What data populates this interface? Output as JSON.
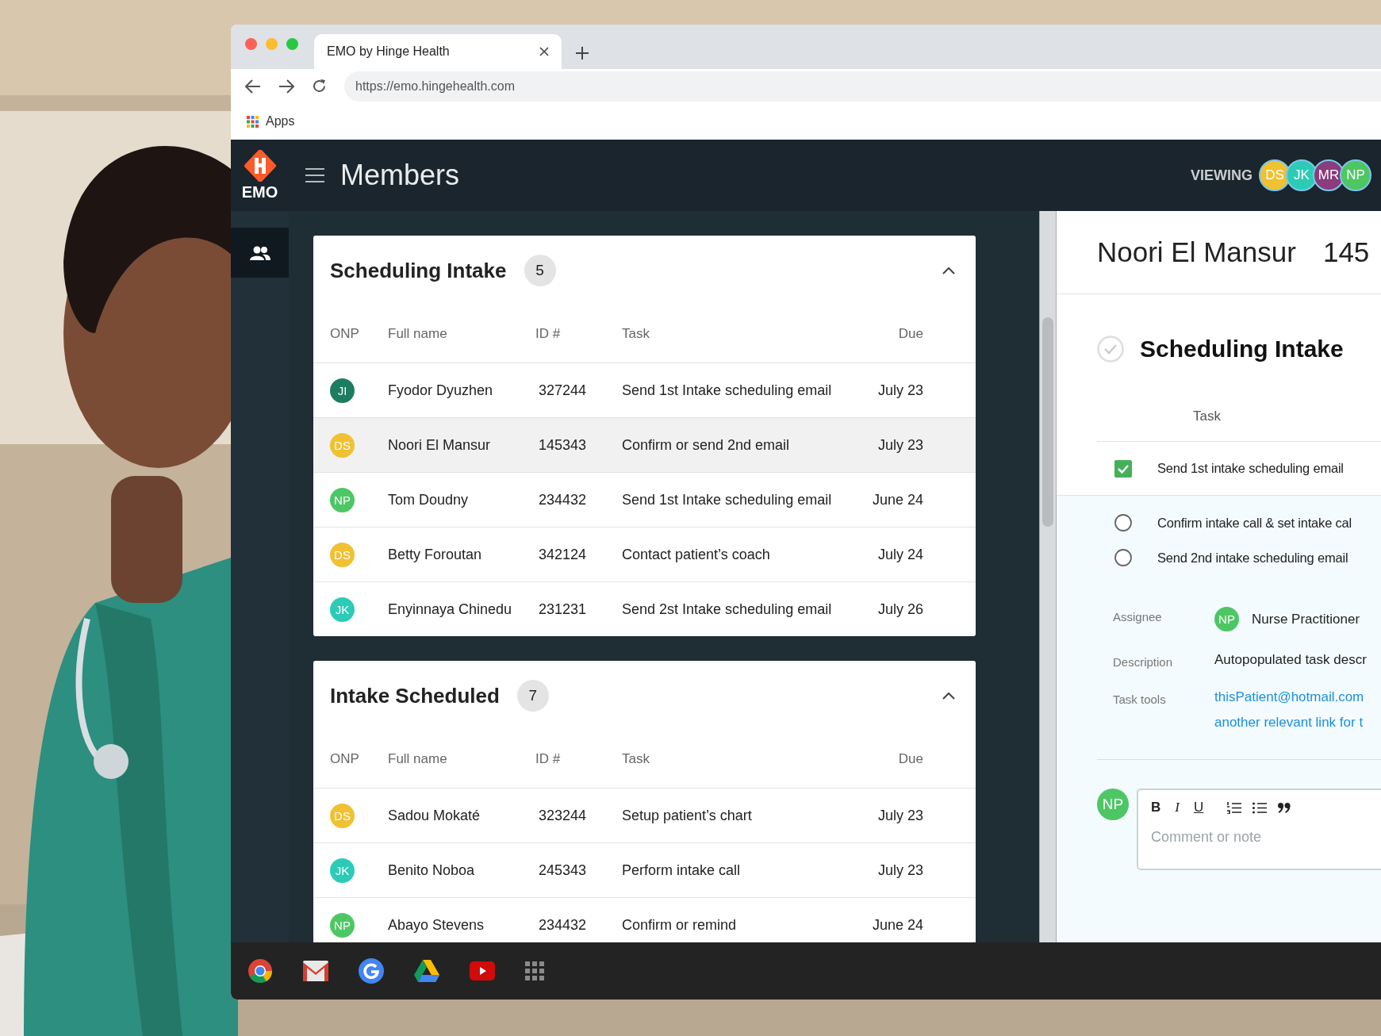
{
  "browser": {
    "tab": {
      "title": "EMO by Hinge Health"
    },
    "url": "https://emo.hingehealth.com",
    "bookmarks": [
      {
        "label": "Apps"
      }
    ]
  },
  "app": {
    "logo": "EMO",
    "title": "Members",
    "viewing_label": "VIEWING",
    "viewers": [
      {
        "initials": "DS",
        "color": "#f0c132"
      },
      {
        "initials": "JK",
        "color": "#2ccbb6"
      },
      {
        "initials": "MR",
        "color": "#8a3c7c"
      },
      {
        "initials": "NP",
        "color": "#4cc764"
      }
    ]
  },
  "sidebar": {
    "items": [
      {
        "selected": true
      }
    ]
  },
  "groups": [
    {
      "title": "Scheduling Intake",
      "count": "5",
      "expanded": true,
      "columns": [
        "ONP",
        "Full name",
        "ID #",
        "Task",
        "Due"
      ],
      "rows": [
        {
          "initials": "JI",
          "color": "#1d7d60",
          "name": "Fyodor Dyuzhen",
          "id": "327244",
          "task": "Send 1st Intake scheduling email",
          "due": "July 23",
          "selected": false
        },
        {
          "initials": "DS",
          "color": "#f0c132",
          "name": "Noori El Mansur",
          "id": "145343",
          "task": "Confirm or send 2nd email",
          "due": "July 23",
          "selected": true
        },
        {
          "initials": "NP",
          "color": "#4cc764",
          "name": "Tom Doudny",
          "id": "234432",
          "task": "Send 1st Intake scheduling email",
          "due": "June 24",
          "selected": false
        },
        {
          "initials": "DS",
          "color": "#f0c132",
          "name": "Betty Foroutan",
          "id": "342124",
          "task": "Contact patient’s coach",
          "due": "July 24",
          "selected": false
        },
        {
          "initials": "JK",
          "color": "#2ccbb6",
          "name": "Enyinnaya Chinedu",
          "id": "231231",
          "task": "Send 2st Intake scheduling email",
          "due": "July 26",
          "selected": false
        }
      ]
    },
    {
      "title": "Intake Scheduled",
      "count": "7",
      "expanded": true,
      "columns": [
        "ONP",
        "Full name",
        "ID #",
        "Task",
        "Due"
      ],
      "rows": [
        {
          "initials": "DS",
          "color": "#f0c132",
          "name": "Sadou Mokaté",
          "id": "323244",
          "task": "Setup patient’s chart",
          "due": "July 23",
          "selected": false
        },
        {
          "initials": "JK",
          "color": "#2ccbb6",
          "name": "Benito Noboa",
          "id": "245343",
          "task": "Perform intake call",
          "due": "July 23",
          "selected": false
        },
        {
          "initials": "NP",
          "color": "#4cc764",
          "name": "Abayo Stevens",
          "id": "234432",
          "task": "Confirm or remind",
          "due": "June 24",
          "selected": false
        }
      ]
    }
  ],
  "detail": {
    "name": "Noori El Mansur",
    "id": "145",
    "section": "Scheduling Intake",
    "task_header": "Task",
    "tasks": [
      {
        "label": "Send 1st intake scheduling email",
        "checked": true
      },
      {
        "label": "Confirm intake call & set intake cal",
        "checked": false
      },
      {
        "label": "Send 2nd intake scheduling email",
        "checked": false
      }
    ],
    "fields": [
      {
        "kind": "assignee",
        "label": "Assignee",
        "initials": "NP",
        "color": "#4cc764",
        "value": "Nurse Practitioner"
      },
      {
        "kind": "text",
        "label": "Description",
        "value": "Autopopulated task descr"
      },
      {
        "kind": "links",
        "label": "Task tools",
        "links": [
          "thisPatient@hotmail.com",
          "another relevant link for t"
        ]
      }
    ],
    "comment": {
      "initials": "NP",
      "color": "#4cc764",
      "format_buttons": [
        "B",
        "I",
        "U"
      ],
      "placeholder": "Comment or note"
    }
  }
}
